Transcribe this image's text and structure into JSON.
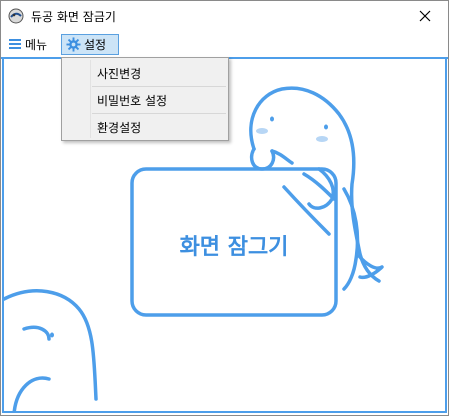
{
  "window": {
    "title": "듀공 화면 잠금기"
  },
  "menubar": {
    "items": [
      {
        "label": "메뉴",
        "icon": "hamburger-icon"
      },
      {
        "label": "설정",
        "icon": "gear-icon"
      }
    ]
  },
  "settings_menu": {
    "items": [
      {
        "label": "사진변경"
      },
      {
        "label": "비밀번호 설정"
      },
      {
        "label": "환경설정"
      }
    ]
  },
  "main": {
    "lock_label": "화면 잠그기"
  },
  "colors": {
    "accent": "#4d9eea",
    "text_accent": "#3d8fe0",
    "menu_highlight": "#cce4f7"
  }
}
